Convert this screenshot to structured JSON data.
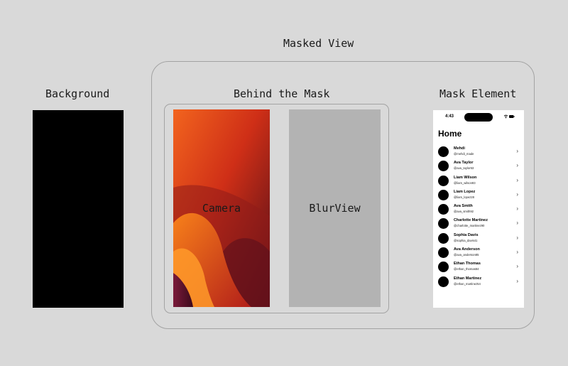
{
  "labels": {
    "masked_view": "Masked View",
    "background": "Background",
    "behind_the_mask": "Behind the Mask",
    "mask_element": "Mask Element"
  },
  "panels": {
    "camera": "Camera",
    "blurview": "BlurView"
  },
  "colors": {
    "page_background": "#d9d9d9",
    "frame_border": "#a3a3a3",
    "background_panel": "#000000",
    "blurview_panel": "#b3b3b3",
    "camera_gradient": [
      "#f05a1e",
      "#c92a18",
      "#5a0f1a"
    ]
  },
  "phone": {
    "time": "4:43",
    "status_icons": "wifi-icon battery-icon",
    "title": "Home",
    "chevron": "›",
    "users": [
      {
        "name": "Mehdi",
        "handle": "@mehdi_made"
      },
      {
        "name": "Ava Taylor",
        "handle": "@ava_taylor63"
      },
      {
        "name": "Liam Wilson",
        "handle": "@liam_wilson93"
      },
      {
        "name": "Liam Lopez",
        "handle": "@liam_lopez28"
      },
      {
        "name": "Ava Smith",
        "handle": "@ava_smith92"
      },
      {
        "name": "Charlotte Martinez",
        "handle": "@charlotte_martinez90"
      },
      {
        "name": "Sophia Davis",
        "handle": "@sophia_davis41"
      },
      {
        "name": "Ava Anderson",
        "handle": "@ava_anderson85"
      },
      {
        "name": "Ethan Thomas",
        "handle": "@ethan_thomas84"
      },
      {
        "name": "Ethan Martinez",
        "handle": "@ethan_martinez54"
      }
    ]
  }
}
